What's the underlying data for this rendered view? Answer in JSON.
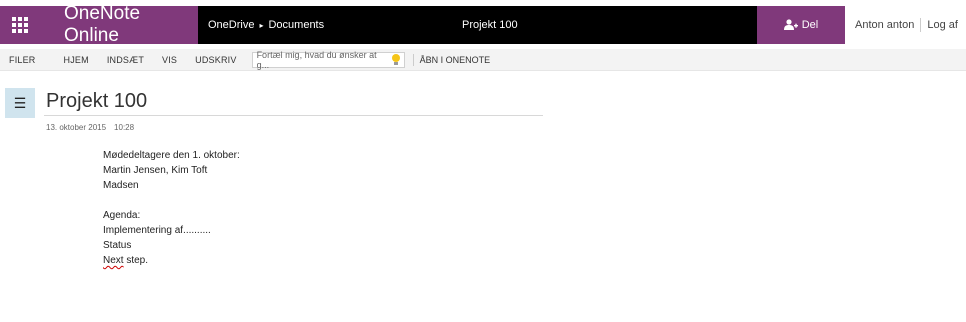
{
  "app": {
    "name": "OneNote Online"
  },
  "breadcrumb": {
    "root": "OneDrive",
    "separator": "▸",
    "folder": "Documents"
  },
  "document": {
    "title": "Projekt 100"
  },
  "share": {
    "label": "Del",
    "icon": "add-person-icon"
  },
  "user": {
    "name": "Anton anton",
    "signout": "Log af"
  },
  "ribbon": {
    "tabs": [
      "FILER",
      "HJEM",
      "INDSÆT",
      "VIS",
      "UDSKRIV"
    ],
    "tellme_placeholder": "Fortæl mig, hvad du ønsker at g...",
    "open_in_app": "ÅBN I ONENOTE"
  },
  "page": {
    "title": "Projekt 100",
    "date": "13. oktober 2015",
    "time": "10:28",
    "lines": [
      "Mødedeltagere den 1. oktober:",
      "Martin Jensen, Kim Toft",
      "Madsen",
      "",
      "Agenda:",
      "Implementering af..........",
      "Status",
      "step."
    ],
    "misspelled_word": "Next"
  },
  "colors": {
    "accent": "#80397b",
    "topbar": "#000000",
    "nav_toggle_bg": "#d0e4ee"
  }
}
